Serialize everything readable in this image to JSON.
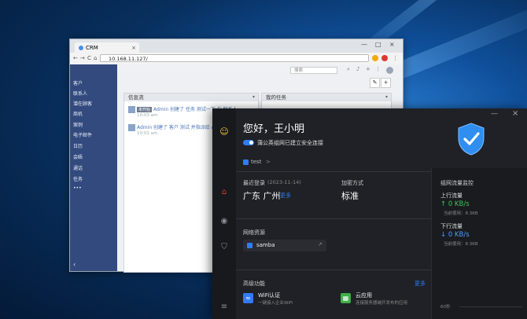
{
  "browser": {
    "tab_title": "CRM",
    "tab_close": "×",
    "window_controls": [
      "—",
      "□",
      "×"
    ],
    "nav_icons": [
      "←",
      "→",
      "C",
      "⌂"
    ],
    "url": "10.168.11.127/",
    "sidebar_items": [
      "客户",
      "联系人",
      "潜在顾客",
      "商机",
      "案例",
      "电子邮件",
      "日历",
      "会晤",
      "通话",
      "任务",
      "•••"
    ],
    "sidebar_collapse": "‹",
    "search_placeholder": "搜索",
    "panels": {
      "feed_title": "信息流",
      "tasks_title": "我的任务"
    },
    "feed": [
      {
        "badge": "未开始",
        "text": "Admin 创建了 任务 测试一下 与 联系人",
        "time": "10:03 am"
      },
      {
        "badge": "",
        "text": "Admin 创建了 客户 测试 并指派给 Admin",
        "time": "10:02 am"
      }
    ]
  },
  "vpn": {
    "greeting": "您好，王小明",
    "status": "蒲公英组网已建立安全连接",
    "network_name": "test",
    "network_chevron": ">",
    "last_login_label": "最近登录",
    "last_login_date": "(2023-11-14)",
    "location": "广东 广州",
    "more_label": "更多",
    "encryption_label": "加密方式",
    "encryption_value": "标准",
    "resources_label": "网络资源",
    "resource_name": "samba",
    "advanced_label": "高级功能",
    "advanced_more": "更多",
    "features": [
      {
        "title": "WiFi认证",
        "desc": "一键接入企业WiFi",
        "color": "#2f7cf6"
      },
      {
        "title": "云应用",
        "desc": "连接服务器端开发布的应用",
        "color": "#3fae49"
      }
    ],
    "traffic": {
      "title": "组网流量监控",
      "up_label": "上行流量",
      "up_value": "↑ 0 KB/s",
      "up_total": "当前使用：8.3KB",
      "down_label": "下行流量",
      "down_value": "↓ 0 KB/s",
      "down_total": "当前使用：8.3KB",
      "time_label": "60秒"
    },
    "window_controls": [
      "—",
      "×"
    ],
    "accent_color": "#2f7cf6"
  }
}
